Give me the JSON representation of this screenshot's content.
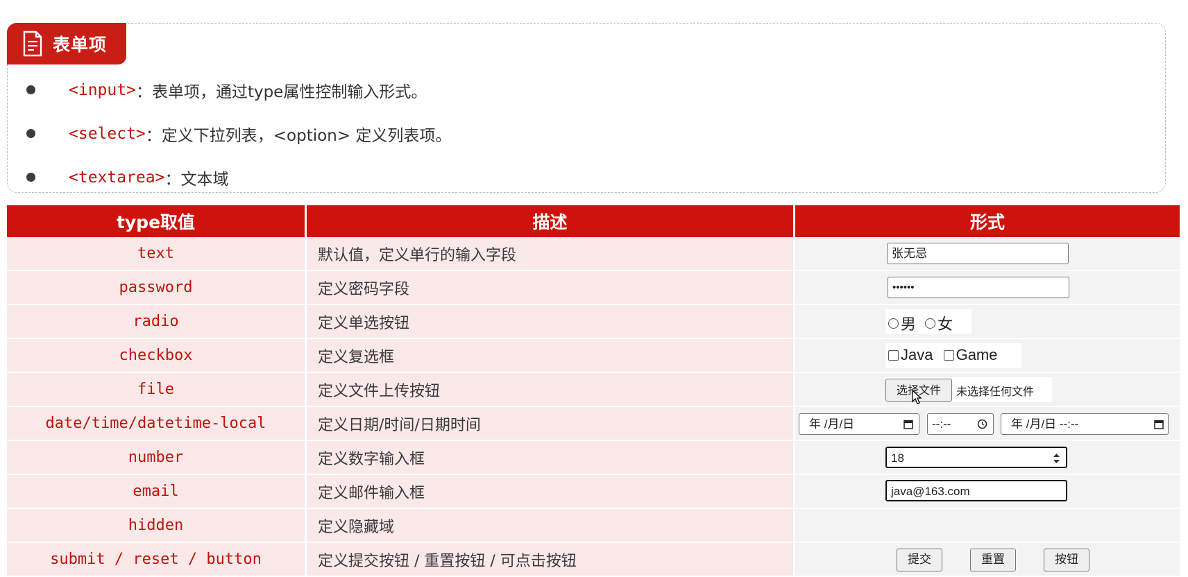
{
  "card": {
    "title": "表单项",
    "items": [
      {
        "tag": "<input>",
        "text": "：表单项，通过type属性控制输入形式。"
      },
      {
        "tag": "<select>",
        "text": "：定义下拉列表，<option> 定义列表项。"
      },
      {
        "tag": "<textarea>",
        "text": "：文本域"
      }
    ]
  },
  "table": {
    "headers": [
      "type取值",
      "描述",
      "形式"
    ],
    "rows": [
      {
        "type": "text",
        "desc": "默认值，定义单行的输入字段"
      },
      {
        "type": "password",
        "desc": "定义密码字段"
      },
      {
        "type": "radio",
        "desc": "定义单选按钮"
      },
      {
        "type": "checkbox",
        "desc": "定义复选框"
      },
      {
        "type": "file",
        "desc": "定义文件上传按钮"
      },
      {
        "type": "date/time/datetime-local",
        "desc": "定义日期/时间/日期时间"
      },
      {
        "type": "number",
        "desc": "定义数字输入框"
      },
      {
        "type": "email",
        "desc": "定义邮件输入框"
      },
      {
        "type": "hidden",
        "desc": "定义隐藏域"
      },
      {
        "type": "submit / reset / button",
        "desc": "定义提交按钮 / 重置按钮 / 可点击按钮"
      }
    ]
  },
  "demo": {
    "text_value": "张无忌",
    "password_value": "••••••",
    "radio_options": [
      "男",
      "女"
    ],
    "checkbox_options": [
      "Java",
      "Game"
    ],
    "file_button": "选择文件",
    "file_status": "未选择任何文件",
    "date_value": "年 /月/日",
    "time_value": "--:--",
    "datetime_value": "年 /月/日 --:--",
    "number_value": "18",
    "email_value": "java@163.com",
    "submit_label": "提交",
    "reset_label": "重置",
    "button_label": "按钮"
  },
  "colors": {
    "accent": "#d0120c",
    "row_bg": "#fbe9e9",
    "form_bg": "#f3f3f3"
  },
  "icons": [
    "document-icon",
    "calendar-icon",
    "clock-icon",
    "spinner-arrows-icon",
    "mouse-cursor-icon"
  ]
}
